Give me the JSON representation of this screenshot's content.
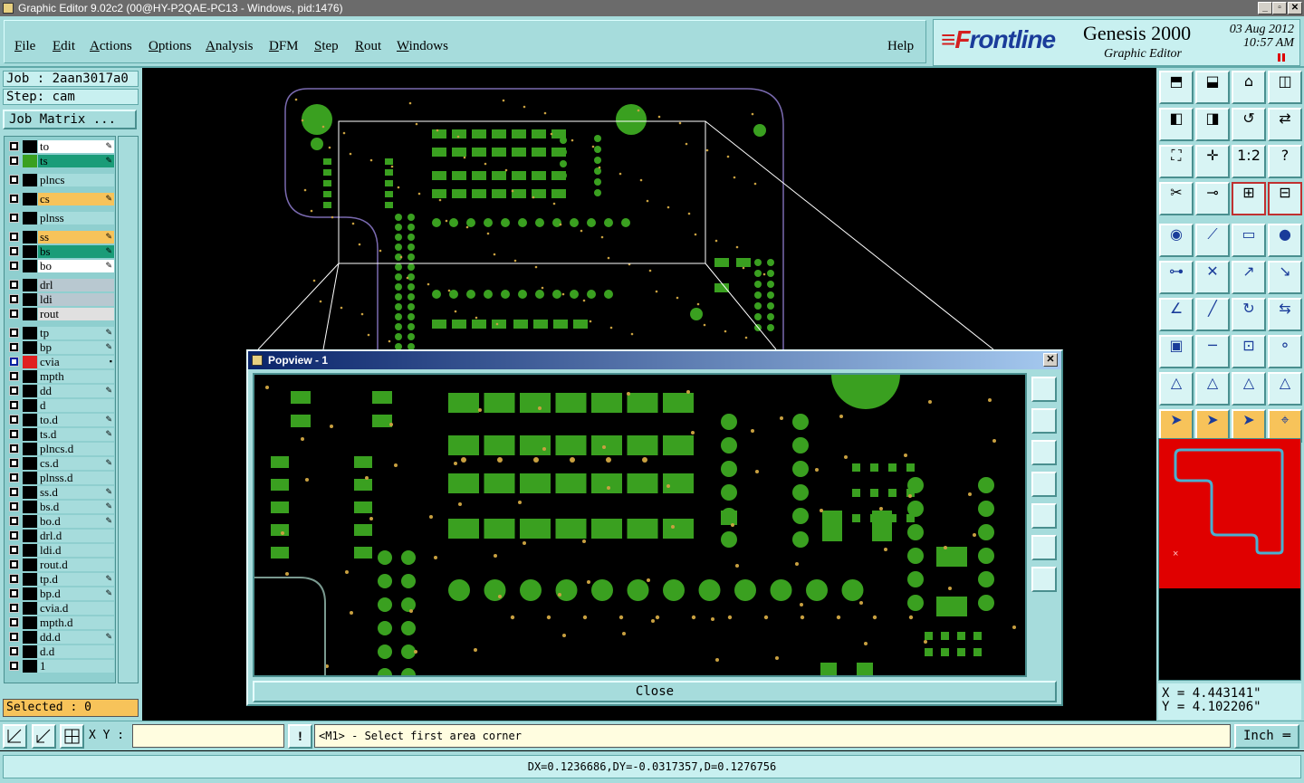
{
  "window": {
    "title": "Graphic Editor 9.02c2 (00@HY-P2QAE-PC13 - Windows, pid:1476)",
    "min": "_",
    "max": "▫",
    "close": "✕"
  },
  "menu": {
    "items": [
      {
        "ul": "F",
        "rest": "ile"
      },
      {
        "ul": "E",
        "rest": "dit"
      },
      {
        "ul": "A",
        "rest": "ctions"
      },
      {
        "ul": "O",
        "rest": "ptions"
      },
      {
        "ul": "A",
        "rest": "nalysis"
      },
      {
        "ul": "D",
        "rest": "FM"
      },
      {
        "ul": "S",
        "rest": "tep"
      },
      {
        "ul": "R",
        "rest": "out"
      },
      {
        "ul": "W",
        "rest": "indows"
      }
    ],
    "help": "Help"
  },
  "brand": {
    "logo_f": "≡F",
    "logo_rest": "rontline",
    "product": "Genesis 2000",
    "subtitle": "Graphic Editor",
    "date": "03 Aug 2012",
    "time": "10:57 AM"
  },
  "job": {
    "job_label": "Job : 2aan3017a0",
    "step_label": "Step: cam",
    "matrix_button": "Job Matrix ..."
  },
  "layers": [
    {
      "name": "to",
      "color": "#ffffff",
      "swatch": "#000000",
      "mark": "✎"
    },
    {
      "name": "ts",
      "color": "#1a9c78",
      "swatch": "#3aa020",
      "mark": "✎"
    },
    {
      "name": "plncs",
      "color": "#a6dcdc",
      "swatch": "#000000",
      "mark": ""
    },
    {
      "name": "cs",
      "color": "#f7c35a",
      "swatch": "#000000",
      "mark": "✎"
    },
    {
      "name": "plnss",
      "color": "#a6dcdc",
      "swatch": "#000000",
      "mark": ""
    },
    {
      "name": "ss",
      "color": "#f7c35a",
      "swatch": "#000000",
      "mark": "✎"
    },
    {
      "name": "bs",
      "color": "#1a9c78",
      "swatch": "#000000",
      "mark": "✎"
    },
    {
      "name": "bo",
      "color": "#ffffff",
      "swatch": "#000000",
      "mark": "✎"
    },
    {
      "name": "drl",
      "color": "#b8c8d0",
      "swatch": "#000000",
      "mark": ""
    },
    {
      "name": "ldi",
      "color": "#b8c8d0",
      "swatch": "#000000",
      "mark": ""
    },
    {
      "name": "rout",
      "color": "#e0e0e0",
      "swatch": "#000000",
      "mark": ""
    },
    {
      "name": "tp",
      "color": "#a6dcdc",
      "swatch": "#000000",
      "mark": "✎"
    },
    {
      "name": "bp",
      "color": "#a6dcdc",
      "swatch": "#000000",
      "mark": "✎"
    },
    {
      "name": "cvia",
      "color": "#a6dcdc",
      "swatch": "#e02020",
      "mark": "▪"
    },
    {
      "name": "mpth",
      "color": "#a6dcdc",
      "swatch": "#000000",
      "mark": ""
    },
    {
      "name": "dd",
      "color": "#a6dcdc",
      "swatch": "#000000",
      "mark": "✎"
    },
    {
      "name": "d",
      "color": "#a6dcdc",
      "swatch": "#000000",
      "mark": ""
    },
    {
      "name": "to.d",
      "color": "#a6dcdc",
      "swatch": "#000000",
      "mark": "✎"
    },
    {
      "name": "ts.d",
      "color": "#a6dcdc",
      "swatch": "#000000",
      "mark": "✎"
    },
    {
      "name": "plncs.d",
      "color": "#a6dcdc",
      "swatch": "#000000",
      "mark": ""
    },
    {
      "name": "cs.d",
      "color": "#a6dcdc",
      "swatch": "#000000",
      "mark": "✎"
    },
    {
      "name": "plnss.d",
      "color": "#a6dcdc",
      "swatch": "#000000",
      "mark": ""
    },
    {
      "name": "ss.d",
      "color": "#a6dcdc",
      "swatch": "#000000",
      "mark": "✎"
    },
    {
      "name": "bs.d",
      "color": "#a6dcdc",
      "swatch": "#000000",
      "mark": "✎"
    },
    {
      "name": "bo.d",
      "color": "#a6dcdc",
      "swatch": "#000000",
      "mark": "✎"
    },
    {
      "name": "drl.d",
      "color": "#a6dcdc",
      "swatch": "#000000",
      "mark": ""
    },
    {
      "name": "ldi.d",
      "color": "#a6dcdc",
      "swatch": "#000000",
      "mark": ""
    },
    {
      "name": "rout.d",
      "color": "#a6dcdc",
      "swatch": "#000000",
      "mark": ""
    },
    {
      "name": "tp.d",
      "color": "#a6dcdc",
      "swatch": "#000000",
      "mark": "✎"
    },
    {
      "name": "bp.d",
      "color": "#a6dcdc",
      "swatch": "#000000",
      "mark": "✎"
    },
    {
      "name": "cvia.d",
      "color": "#a6dcdc",
      "swatch": "#000000",
      "mark": ""
    },
    {
      "name": "mpth.d",
      "color": "#a6dcdc",
      "swatch": "#000000",
      "mark": ""
    },
    {
      "name": "dd.d",
      "color": "#a6dcdc",
      "swatch": "#000000",
      "mark": "✎"
    },
    {
      "name": "d.d",
      "color": "#a6dcdc",
      "swatch": "#000000",
      "mark": ""
    },
    {
      "name": "1",
      "color": "#a6dcdc",
      "swatch": "#000000",
      "mark": ""
    }
  ],
  "selected": "Selected : 0",
  "coords": {
    "x": "X = 4.443141\"",
    "y": "Y = 4.102206\""
  },
  "popview": {
    "title": "Popview - 1",
    "close_label": "Close"
  },
  "prompt": {
    "xy_label": "X Y :",
    "input_value": "",
    "message": "<M1> - Select first area corner",
    "bang": "!",
    "units": "Inch"
  },
  "status": "DX=0.1236686,DY=-0.0317357,D=0.1276756",
  "colors": {
    "panel": "#a6dcdc",
    "pad": "#3aa020",
    "drill": "#c8a040",
    "highlight": "#f7c35a",
    "accent_red": "#e00000"
  }
}
